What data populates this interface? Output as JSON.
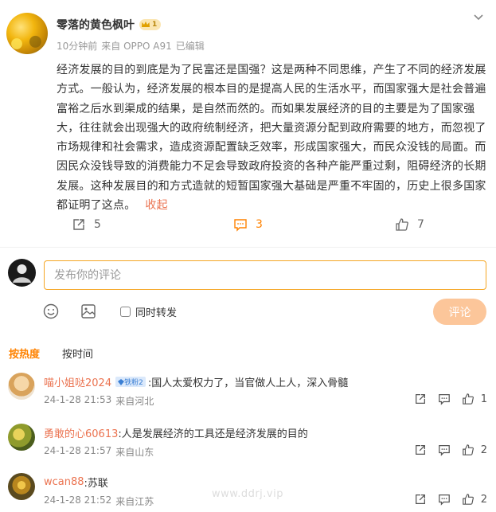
{
  "post": {
    "author": "零落的黄色枫叶",
    "level": "1",
    "meta": {
      "time": "10分钟前",
      "source": "来自 OPPO A91",
      "edited": "已编辑"
    },
    "content": "经济发展的目的到底是为了民富还是国强？这是两种不同思维，产生了不同的经济发展方式。一般认为，经济发展的根本目的是提高人民的生活水平，而国家强大是社会普遍富裕之后水到渠成的结果，是自然而然的。而如果发展经济的目的主要是为了国家强大，往往就会出现强大的政府统制经济，把大量资源分配到政府需要的地方，而忽视了市场规律和社会需求，造成资源配置缺乏效率，形成国家强大，而民众没钱的局面。而因民众没钱导致的消费能力不足会导致政府投资的各种产能严重过剩，阻碍经济的长期发展。这种发展目的和方式造就的短暂国家强大基础是严重不牢固的，历史上很多国家都证明了这点。",
    "collapse_label": "收起",
    "stats": {
      "reposts": "5",
      "comments": "3",
      "likes": "7"
    }
  },
  "composer": {
    "placeholder": "发布你的评论",
    "forward_label": "同时转发",
    "submit_label": "评论"
  },
  "sort": {
    "hot": "按热度",
    "time": "按时间"
  },
  "comments": [
    {
      "user": "喵小姐哒2024",
      "badge": "铁粉2",
      "text": ":国人太爱权力了，当官做人上人，深入骨髓",
      "date": "24-1-28 21:53",
      "location": "来自河北",
      "likes": "1"
    },
    {
      "user": "勇敢的心60613",
      "badge": "",
      "text": ":人是发展经济的工具还是经济发展的目的",
      "date": "24-1-28 21:57",
      "location": "来自山东",
      "likes": "2"
    },
    {
      "user": "wcan88",
      "badge": "",
      "text": ":苏联",
      "date": "24-1-28 21:52",
      "location": "来自江苏",
      "likes": "2"
    }
  ],
  "watermark": "www.ddrj.vip",
  "colors": {
    "accent": "#ff8200",
    "link": "#eb7350",
    "submit_disabled": "#fcc69a"
  }
}
